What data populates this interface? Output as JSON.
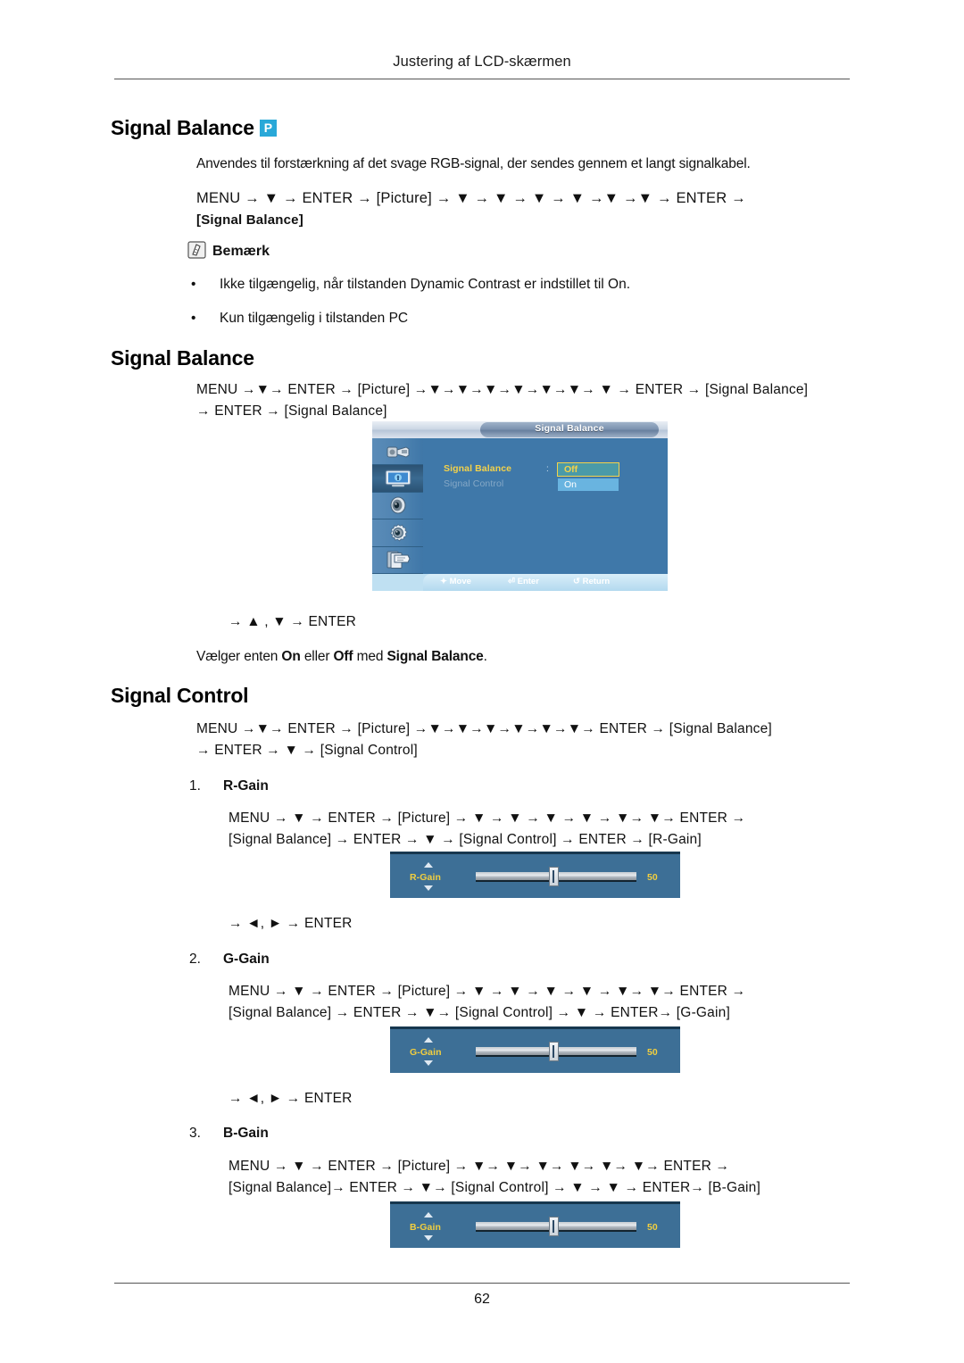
{
  "header": {
    "running_title": "Justering af LCD-skærmen",
    "page_number": "62"
  },
  "section_1": {
    "heading": "Signal Balance",
    "badge": "P",
    "description": "Anvendes til forstærkning af det svage RGB-signal, der sendes gennem et langt signalkabel.",
    "path_line_1": "MENU → ▼ → ENTER → [Picture] → ▼ → ▼ → ▼ → ▼ →▼ →▼ → ENTER →",
    "path_line_2": "[Signal Balance]",
    "note_label": "Bemærk",
    "note_icon": "note-hand-icon",
    "bullets": [
      "Ikke tilgængelig, når tilstanden Dynamic Contrast er indstillet til On.",
      "Kun tilgængelig i tilstanden PC"
    ]
  },
  "section_2": {
    "heading": "Signal Balance",
    "path_line_1": "MENU →▼→ ENTER → [Picture] →▼→▼→▼→▼→▼→▼→ ▼ → ENTER → [Signal Balance]",
    "path_line_2": "→ ENTER → [Signal Balance]",
    "after_path": "→ ▲ , ▼ → ENTER",
    "explanation_prefix": "Vælger enten ",
    "explanation_on": "On",
    "explanation_mid": " eller ",
    "explanation_off": "Off",
    "explanation_mid2": " med ",
    "explanation_bold": "Signal Balance",
    "explanation_suffix": "."
  },
  "osd": {
    "title": "Signal Balance",
    "sidebar_icons": [
      "input-connector-icon",
      "picture-display-icon",
      "sound-speaker-icon",
      "setup-gear-icon",
      "multi-control-pages-icon"
    ],
    "selected_sidebar_index": 1,
    "rows": [
      {
        "label": "Signal Balance",
        "state": "active"
      },
      {
        "label": "Signal Control",
        "state": "dim"
      }
    ],
    "colon": ":",
    "options": [
      {
        "label": "Off",
        "selected": true
      },
      {
        "label": "On",
        "selected": false
      }
    ],
    "footer": [
      {
        "icon": "move-icon",
        "label": "Move"
      },
      {
        "icon": "enter-icon",
        "label": "Enter"
      },
      {
        "icon": "return-icon",
        "label": "Return"
      }
    ],
    "colors": {
      "background": "#3f78a9",
      "highlight_yellow": "#f4d24a",
      "option_selected_bg": "#4a9aa8",
      "option_unselected_bg": "#69b4e0",
      "footer_bg": "#bfe0f2"
    }
  },
  "section_3": {
    "heading": "Signal Control",
    "path_line_1": "MENU →▼→ ENTER → [Picture] →▼→▼→▼→▼→▼→▼→ ENTER → [Signal Balance]",
    "path_line_2": "→ ENTER → ▼ → [Signal Control]",
    "items": [
      {
        "number": "1.",
        "label": "R-Gain",
        "path_line_1": "MENU → ▼ → ENTER → [Picture] → ▼ → ▼ → ▼ → ▼ → ▼→ ▼→ ENTER →",
        "path_line_2": "[Signal Balance] → ENTER → ▼ → [Signal Control] → ENTER → [R-Gain]",
        "after_path": "→ ◄, ► → ENTER",
        "widget": {
          "name": "R-Gain",
          "value": "50",
          "min": 0,
          "max": 100
        }
      },
      {
        "number": "2.",
        "label": "G-Gain",
        "path_line_1": "MENU → ▼ → ENTER → [Picture] → ▼ → ▼ → ▼ → ▼ → ▼→ ▼→ ENTER →",
        "path_line_2": "[Signal Balance] → ENTER → ▼→ [Signal Control] → ▼ → ENTER→ [G-Gain]",
        "after_path": "→ ◄, ► → ENTER",
        "widget": {
          "name": "G-Gain",
          "value": "50",
          "min": 0,
          "max": 100
        }
      },
      {
        "number": "3.",
        "label": "B-Gain",
        "path_line_1": "MENU → ▼ → ENTER → [Picture] → ▼→ ▼→ ▼→ ▼→ ▼→ ▼→ ENTER →",
        "path_line_2": "[Signal Balance]→ ENTER → ▼→ [Signal Control] → ▼ → ▼ → ENTER→ [B-Gain]",
        "after_path": "",
        "widget": {
          "name": "B-Gain",
          "value": "50",
          "min": 0,
          "max": 100
        }
      }
    ]
  }
}
